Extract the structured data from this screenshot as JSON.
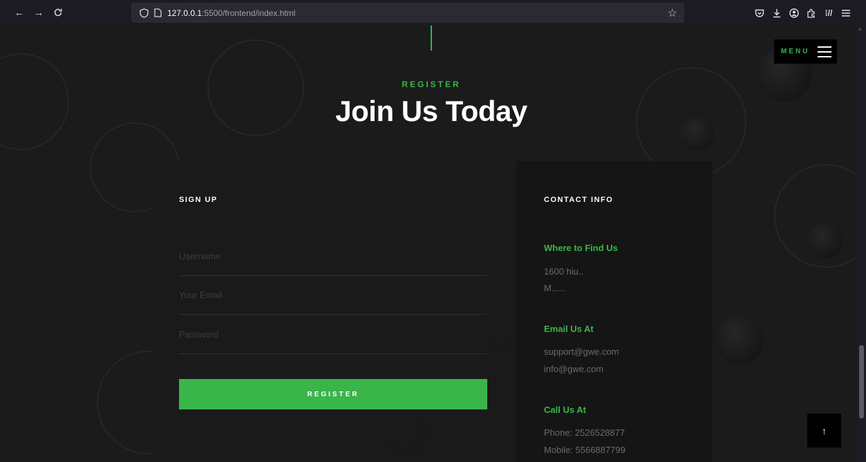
{
  "browser": {
    "url_host": "127.0.0.1",
    "url_path": ":5500/frontend/index.html",
    "nav": {
      "back": "←",
      "forward": "→",
      "reload": "C"
    }
  },
  "menu": {
    "label": "MENU"
  },
  "header": {
    "eyebrow": "REGISTER",
    "title": "Join Us Today"
  },
  "signup": {
    "heading": "SIGN UP",
    "username_placeholder": "Username",
    "email_placeholder": "Your Email",
    "password_placeholder": "Password",
    "button_label": "REGISTER"
  },
  "contact": {
    "heading": "CONTACT INFO",
    "find": {
      "title": "Where to Find Us",
      "line1": "1600 hiu..",
      "line2": "M......"
    },
    "email": {
      "title": "Email Us At",
      "line1": "support@gwe.com",
      "line2": "info@gwe.com"
    },
    "call": {
      "title": "Call Us At",
      "line1": "Phone: 2526528877",
      "line2": "Mobile: 5566887799"
    }
  },
  "back_to_top": "↑",
  "colors": {
    "accent": "#39b54a",
    "background": "#1b1b1b",
    "card": "#1a1a1a",
    "sidebar": "#151515"
  },
  "icons": [
    "back-icon",
    "forward-icon",
    "reload-icon",
    "shield-icon",
    "page-icon",
    "bookmark-star-icon",
    "pocket-icon",
    "download-icon",
    "account-icon",
    "extensions-icon",
    "reader-icon",
    "app-menu-icon",
    "hamburger-icon",
    "arrow-up-icon"
  ]
}
